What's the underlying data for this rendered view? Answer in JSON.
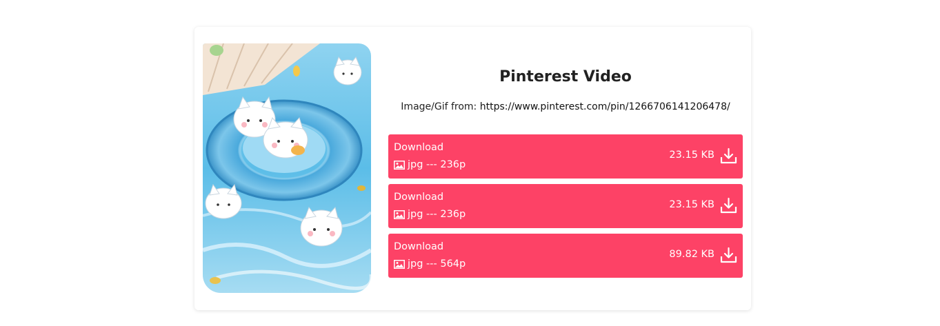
{
  "colors": {
    "accent": "#fd4266",
    "text": "#222222",
    "card_bg": "#ffffff"
  },
  "preview": {
    "icon": "image-preview",
    "description_kind": "thumbnail"
  },
  "title": "Pinterest Video",
  "source": {
    "prefix": "Image/Gif from:",
    "url": "https://www.pinterest.com/pin/1266706141206478/"
  },
  "downloads": [
    {
      "label": "Download",
      "format": "jpg --- 236p",
      "size": "23.15 KB",
      "icon": "download-icon"
    },
    {
      "label": "Download",
      "format": "jpg --- 236p",
      "size": "23.15 KB",
      "icon": "download-icon"
    },
    {
      "label": "Download",
      "format": "jpg --- 564p",
      "size": "89.82 KB",
      "icon": "download-icon"
    }
  ]
}
